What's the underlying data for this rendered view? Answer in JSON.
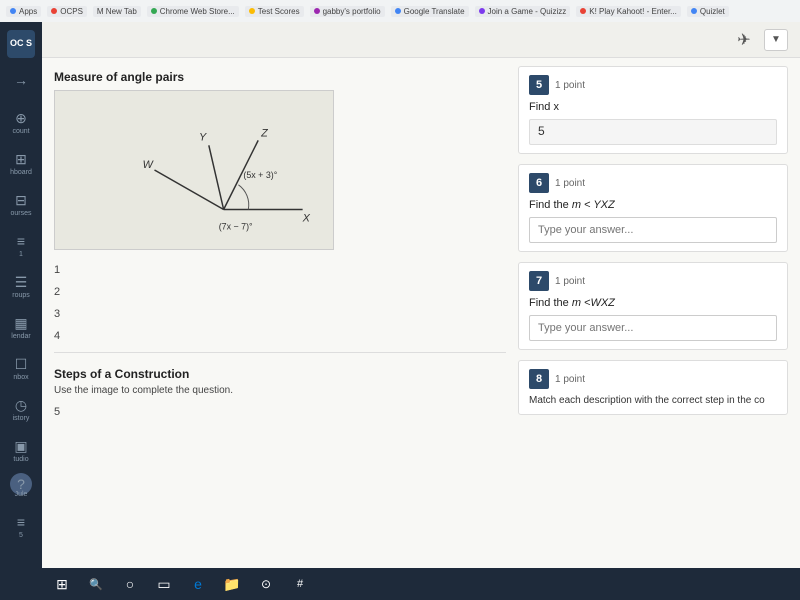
{
  "browser": {
    "tabs": [
      {
        "label": "Apps",
        "color": "#e8eaed"
      },
      {
        "label": "OCPS",
        "color": "#e8eaed"
      },
      {
        "label": "M New Tab",
        "color": "#e8eaed"
      },
      {
        "label": "Chrome Web Store...",
        "color": "#e8eaed"
      },
      {
        "label": "Test Scores",
        "color": "#e8eaed"
      },
      {
        "label": "gabby's portfolio",
        "color": "#e8eaed"
      },
      {
        "label": "Google Translate",
        "color": "#e8eaed"
      },
      {
        "label": "Join a Game - Quizizz",
        "color": "#e8eaed"
      },
      {
        "label": "K! Play Kahoot! - Enter...",
        "color": "#e8eaed"
      },
      {
        "label": "Quizlet",
        "color": "#e8eaed"
      }
    ]
  },
  "sidebar": {
    "logo": "OC\nS",
    "items": [
      {
        "icon": "→",
        "label": ""
      },
      {
        "icon": "⊕",
        "label": "count"
      },
      {
        "icon": "⊞",
        "label": "hboard"
      },
      {
        "icon": "⊟",
        "label": "ourses"
      },
      {
        "icon": "≡",
        "label": "1"
      },
      {
        "icon": "☰",
        "label": "roups"
      },
      {
        "icon": "▦",
        "label": "lendar"
      },
      {
        "icon": "☐",
        "label": "nbox"
      },
      {
        "icon": "◷",
        "label": "istory"
      },
      {
        "icon": "▣",
        "label": "tudio"
      },
      {
        "icon": "?",
        "label": "Jule"
      },
      {
        "icon": "≡",
        "label": "5"
      }
    ]
  },
  "topbar": {
    "collapse_label": "▼",
    "nav_icon": "✈"
  },
  "page": {
    "section1": {
      "title": "Measure of angle pairs",
      "diagram": {
        "labels": [
          "Z",
          "Y",
          "W",
          "X"
        ],
        "expressions": [
          "(5x + 3)°",
          "(7x − 7)°"
        ]
      },
      "questions_left": [
        {
          "number": "1",
          "text": ""
        },
        {
          "number": "2",
          "text": ""
        },
        {
          "number": "3",
          "text": ""
        },
        {
          "number": "4",
          "text": ""
        }
      ]
    },
    "section2": {
      "title": "Steps of a Construction",
      "description": "Use the image to complete the question.",
      "questions_left": [
        {
          "number": "5",
          "text": ""
        }
      ]
    }
  },
  "right_questions": [
    {
      "number": "5",
      "points": "1 point",
      "question": "Find x",
      "answer_type": "display",
      "answer_value": "5"
    },
    {
      "number": "6",
      "points": "1 point",
      "question": "Find the m < YXZ",
      "answer_type": "input",
      "placeholder": "Type your answer..."
    },
    {
      "number": "7",
      "points": "1 point",
      "question": "Find the m <WXZ",
      "answer_type": "input",
      "placeholder": "Type your answer..."
    },
    {
      "number": "8",
      "points": "1 point",
      "question": "Match each description with the correct step in the co",
      "answer_type": "match"
    }
  ]
}
